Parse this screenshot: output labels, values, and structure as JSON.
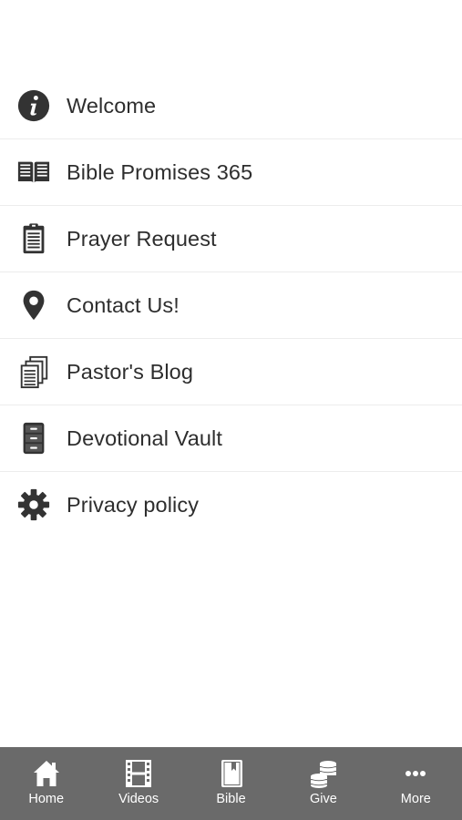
{
  "menu": {
    "items": [
      {
        "label": "Welcome",
        "icon": "info-icon"
      },
      {
        "label": "Bible Promises 365",
        "icon": "open-book-icon"
      },
      {
        "label": "Prayer Request",
        "icon": "clipboard-icon"
      },
      {
        "label": "Contact Us!",
        "icon": "map-pin-icon"
      },
      {
        "label": "Pastor's Blog",
        "icon": "documents-icon"
      },
      {
        "label": "Devotional Vault",
        "icon": "file-cabinet-icon"
      },
      {
        "label": "Privacy policy",
        "icon": "gear-icon"
      }
    ]
  },
  "tabbar": {
    "background": "#6a6a6a",
    "tabs": [
      {
        "label": "Home",
        "icon": "home-icon"
      },
      {
        "label": "Videos",
        "icon": "film-icon"
      },
      {
        "label": "Bible",
        "icon": "bible-icon"
      },
      {
        "label": "Give",
        "icon": "coins-icon"
      },
      {
        "label": "More",
        "icon": "more-icon"
      }
    ]
  },
  "colors": {
    "text": "#2e2e2e",
    "icon": "#333333",
    "divider": "#ececec",
    "tab_text": "#ffffff"
  }
}
